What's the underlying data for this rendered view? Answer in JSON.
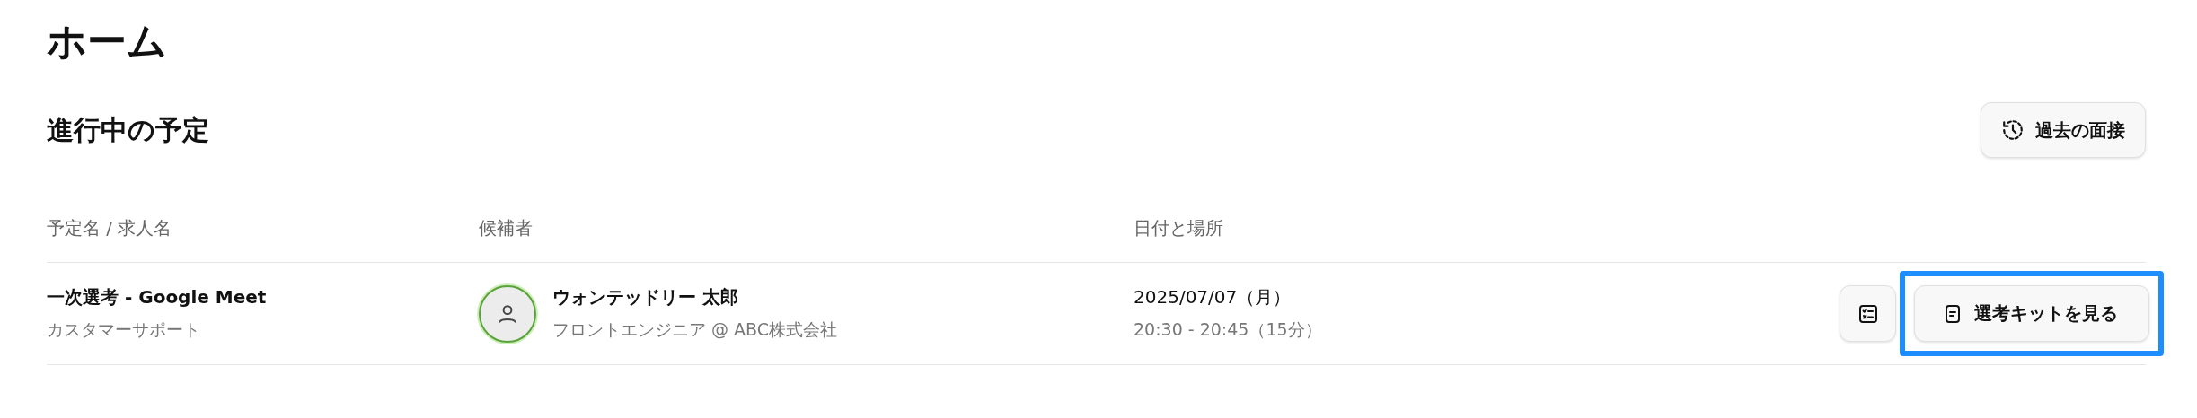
{
  "page": {
    "title": "ホーム"
  },
  "section": {
    "title": "進行中の予定",
    "past_button": {
      "label": "過去の面接"
    }
  },
  "table": {
    "columns": [
      "予定名 / 求人名",
      "候補者",
      "日付と場所"
    ],
    "rows": [
      {
        "event": "一次選考 - Google Meet",
        "job": "カスタマーサポート",
        "candidate": "ウォンテッドリー 太郎",
        "candidate_detail": "フロントエンジニア @ ABC株式会社",
        "date": "2025/07/07（月）",
        "time": "20:30 - 20:45（15分）",
        "kit_button": {
          "label": "選考キットを見る",
          "highlighted": true
        }
      }
    ]
  }
}
